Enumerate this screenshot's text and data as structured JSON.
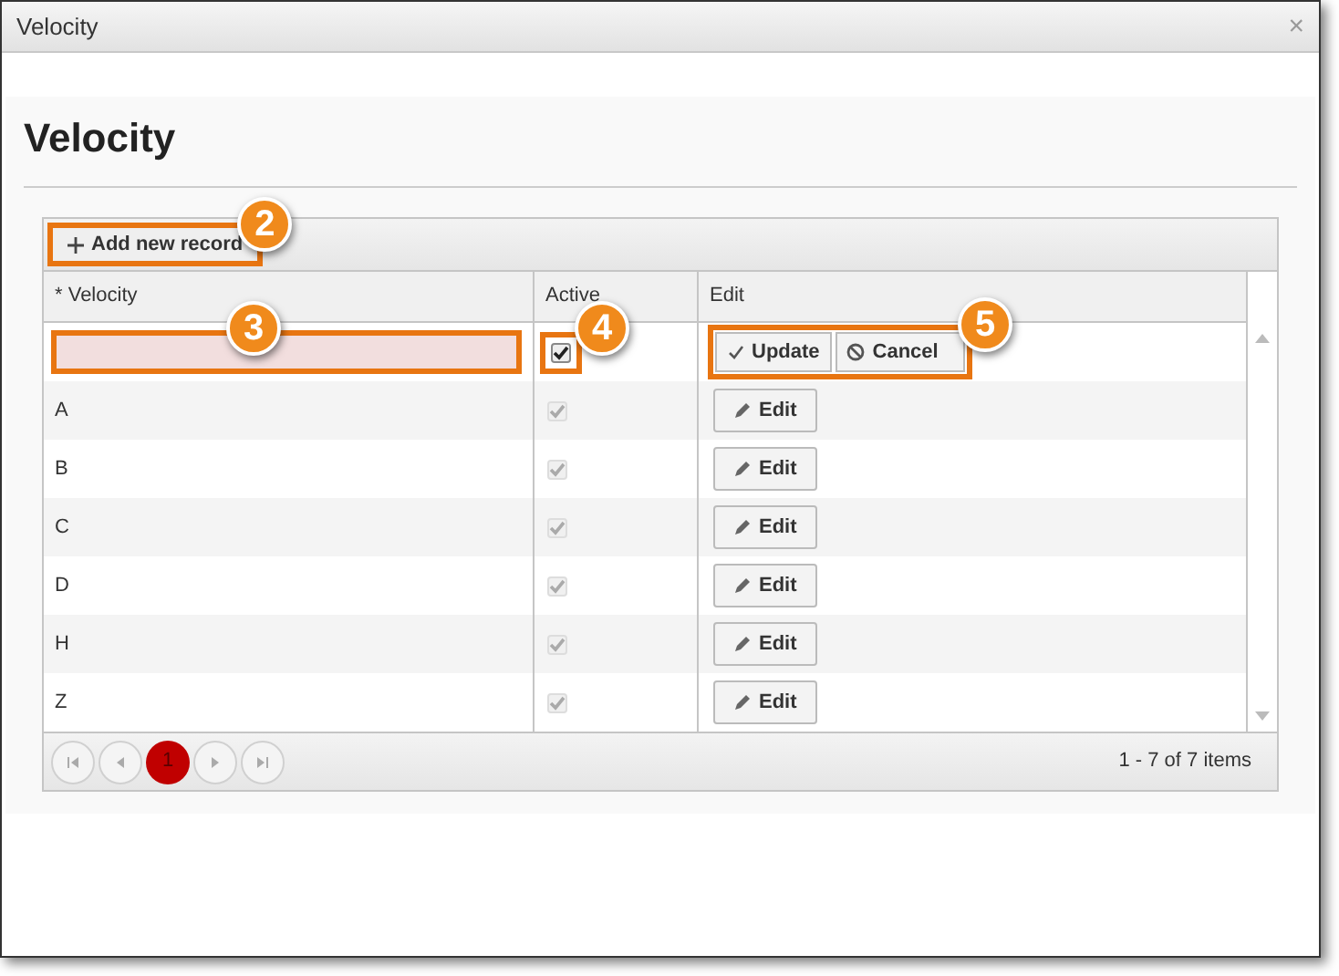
{
  "window": {
    "title": "Velocity",
    "close": "×"
  },
  "page_title": "Velocity",
  "toolbar": {
    "add_button": {
      "label": "Add new record",
      "callout": "2"
    }
  },
  "table": {
    "columns": [
      "* Velocity",
      "Active",
      "Edit"
    ],
    "rows": [
      {
        "kind": "edit",
        "velocity": "",
        "active": true,
        "velocity_callout": "3",
        "active_callout": "4",
        "actions_callout": "5",
        "update": "Update",
        "cancel": "Cancel"
      },
      {
        "kind": "view",
        "velocity": "A",
        "active": true,
        "edit": "Edit"
      },
      {
        "kind": "view",
        "velocity": "B",
        "active": true,
        "edit": "Edit"
      },
      {
        "kind": "view",
        "velocity": "C",
        "active": true,
        "edit": "Edit"
      },
      {
        "kind": "view",
        "velocity": "D",
        "active": true,
        "edit": "Edit"
      },
      {
        "kind": "view",
        "velocity": "H",
        "active": true,
        "edit": "Edit"
      },
      {
        "kind": "view",
        "velocity": "Z",
        "active": true,
        "edit": "Edit"
      }
    ]
  },
  "pager": {
    "pages": [
      {
        "label": "1",
        "selected": true
      }
    ],
    "summary": "1 - 7 of 7 items"
  }
}
